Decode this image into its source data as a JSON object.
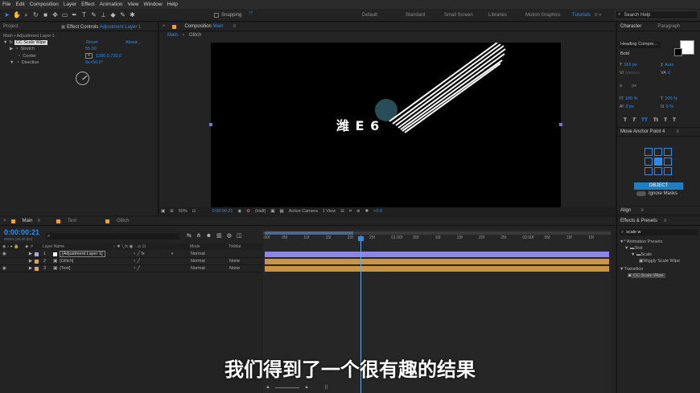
{
  "menu": [
    "File",
    "Edit",
    "Composition",
    "Layer",
    "Effect",
    "Animation",
    "View",
    "Window",
    "Help"
  ],
  "toolbar": {
    "snapping": "Snapping",
    "workspaces": [
      "Default",
      "Standard",
      "Small Screen",
      "Libraries",
      "Motion Graphics",
      "Tutorials"
    ],
    "active_workspace": "Tutorials",
    "search_placeholder": "Search Help"
  },
  "project_panel": {
    "tab_project": "Project",
    "tab_effect_controls": "Effect Controls",
    "effect_controls_layer": "Adjustment Layer 1",
    "breadcrumb": "Main • Adjustment Layer 1",
    "effect": {
      "name": "CC Scale Wipe",
      "reset": "Reset",
      "about": "About...",
      "props": [
        {
          "name": "Stretch",
          "value": "55.00"
        },
        {
          "name": "Center",
          "value": "1280.0,720.0"
        },
        {
          "name": "Direction",
          "value": "0x+50.0°"
        }
      ]
    }
  },
  "comp_panel": {
    "tab": "Composition",
    "comp_name": "Main",
    "nav": [
      "Main",
      "Glitch"
    ],
    "footer": {
      "zoom": "50%",
      "timecode": "0:00:00:21",
      "resolution": "(Half)",
      "camera": "Active Camera",
      "views": "1 View",
      "exposure": "+0.0"
    }
  },
  "character": {
    "tab": "Character",
    "tab2": "Paragraph",
    "font": "Heading Compre...",
    "style": "Bold",
    "size": "165 px",
    "leading": "Auto",
    "tracking": "Metrics",
    "kerning": "0",
    "stroke": "px",
    "vscale": "100 %",
    "hscale": "100 %",
    "baseline": "0 px",
    "tsume": "0 %",
    "caps": [
      "T",
      "T",
      "TT",
      "Tt",
      "T",
      "T",
      "T"
    ]
  },
  "anchor": {
    "title": "Move Anchor Point 4",
    "button": "OBJECT",
    "option": "Ignore Masks"
  },
  "align": {
    "tab": "Align"
  },
  "effects": {
    "tab": "Effects & Presets",
    "search": "scale w",
    "tree": [
      {
        "label": "* Animation Presets",
        "level": 0
      },
      {
        "label": "Text",
        "level": 1
      },
      {
        "label": "Scale",
        "level": 2
      },
      {
        "label": "Wiggly Scale Wipe",
        "level": 3
      },
      {
        "label": "Transition",
        "level": 0
      },
      {
        "label": "CC Scale Wipe",
        "level": 1,
        "selected": true
      }
    ]
  },
  "timeline": {
    "tabs": [
      "Main",
      "Text",
      "Glitch"
    ],
    "timecode": "0:00:00:21",
    "fps": "00021 (30.00 fps)",
    "search_placeholder": "",
    "columns": {
      "num": "#",
      "name": "Layer Name",
      "mode": "Mode",
      "trkmat": "TrkMat"
    },
    "layers": [
      {
        "num": "1",
        "name": "[Adjustment Layer 1]",
        "mode": "Normal",
        "trkmat": "",
        "color": "#a6a6ff"
      },
      {
        "num": "2",
        "name": "[Glitch]",
        "mode": "Normal",
        "trkmat": "None",
        "color": "#e8a43a"
      },
      {
        "num": "3",
        "name": "[Text]",
        "mode": "Normal",
        "trkmat": "None",
        "color": "#e8a43a"
      }
    ],
    "ruler": [
      ":00f",
      "05f",
      "10f",
      "15f",
      "20f",
      "25f",
      "01:00f",
      "05f",
      "10f",
      "15f",
      "20f",
      "25f",
      "02:00f",
      "05f",
      "10f",
      "15f"
    ]
  },
  "canvas_text": "潍 E 6",
  "subtitle": "我们得到了一个很有趣的结果"
}
